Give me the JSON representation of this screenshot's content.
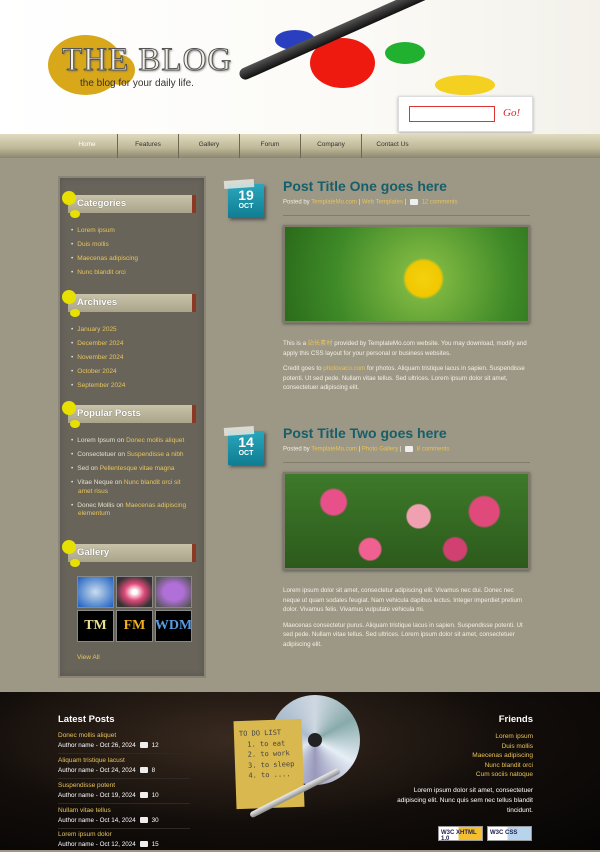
{
  "header": {
    "logo_title": "THE BLOG",
    "tagline": "the blog for your daily life.",
    "search_placeholder": "",
    "search_button": "Go!"
  },
  "nav": [
    {
      "label": "Home",
      "active": true
    },
    {
      "label": "Features"
    },
    {
      "label": "Gallery"
    },
    {
      "label": "Forum"
    },
    {
      "label": "Company"
    },
    {
      "label": "Contact Us"
    }
  ],
  "sidebar": {
    "categories": {
      "title": "Categories",
      "items": [
        "Lorem ipsum",
        "Duis mollis",
        "Maecenas adipiscing",
        "Nunc blandit orci"
      ]
    },
    "archives": {
      "title": "Archives",
      "items": [
        "January 2025",
        "December 2024",
        "November 2024",
        "October 2024",
        "September 2024"
      ]
    },
    "popular": {
      "title": "Popular Posts",
      "items": [
        {
          "author": "Lorem Ipsum",
          "on": "on",
          "link": "Donec mollis aliquet"
        },
        {
          "author": "Consectetuer",
          "on": "on",
          "link": "Suspendisse a nibh"
        },
        {
          "author": "Sed",
          "on": "on",
          "link": "Pellentesque vitae magna"
        },
        {
          "author": "Vitae Neque",
          "on": "on",
          "link": "Nunc blandit orci sit amet risus"
        },
        {
          "author": "Donec Mollis",
          "on": "on",
          "link": "Maecenas adipiscing elementum"
        }
      ]
    },
    "gallery": {
      "title": "Gallery",
      "thumbs": [
        "fish",
        "carnation",
        "petunia",
        "TM",
        "FM",
        "WDM"
      ],
      "view_all": "View All"
    }
  },
  "posts": [
    {
      "day": "19",
      "month": "OCT",
      "title": "Post Title One goes here",
      "posted_by": "Posted by",
      "author": "TemplateMo.com",
      "sep": "|",
      "category": "Web Templates",
      "comments": "12 comments",
      "p1_pre": "This is a ",
      "p1_link": "站长素材",
      "p1_post": " provided by TemplateMo.com website. You may download, modify and apply this CSS layout for your personal or business websites.",
      "p2_pre": "Credit goes to ",
      "p2_link": "photovaco.com",
      "p2_post": " for photos. Aliquam tristique lacus in sapien. Suspendisse potenti. Ut sed pede. Nullam vitae tellus. Sed ultrices. Lorem ipsum dolor sit amet, consectetuer adipiscing elit."
    },
    {
      "day": "14",
      "month": "OCT",
      "title": "Post Title Two goes here",
      "posted_by": "Posted by",
      "author": "TemplateMo.com",
      "sep": "|",
      "category": "Photo Gallery",
      "comments": "8 comments",
      "p1": "Lorem ipsum dolor sit amet, consectetur adipiscing elit. Vivamus nec dui. Donec nec neque ut quam sodales feugiat. Nam vehicula dapibus lectus. Integer imperdiet pretium dolor. Vivamus felis. Vivamus vulputate vehicula mi.",
      "p2": "Maecenas consectetur purus. Aliquam tristique lacus in sapien. Suspendisse potenti. Ut sed pede. Nullam vitae tellus. Sed ultrices. Lorem ipsum dolor sit amet, consectetuer adipiscing elit."
    }
  ],
  "footer": {
    "latest_title": "Latest Posts",
    "latest": [
      {
        "title": "Donec mollis aliquet",
        "meta": "Author name - Oct 26, 2024",
        "comments": "12"
      },
      {
        "title": "Aliquam tristique lacust",
        "meta": "Author name - Oct 24, 2024",
        "comments": "8"
      },
      {
        "title": "Suspendisse potent",
        "meta": "Author name - Oct 19, 2024",
        "comments": "10"
      },
      {
        "title": "Nullam vitae tellus",
        "meta": "Author name - Oct 14, 2024",
        "comments": "30"
      },
      {
        "title": "Lorem ipsum dolor",
        "meta": "Author name - Oct 12, 2024",
        "comments": "15"
      }
    ],
    "todo": {
      "title": "TO DO LIST",
      "items": [
        "1. to eat",
        "2. to work",
        "3. to sleep",
        "4. to ...."
      ]
    },
    "friends_title": "Friends",
    "friends": [
      "Lorem ipsum",
      "Duis mollis",
      "Maecenas adipiscing",
      "Nunc blandit orci",
      "Cum sociis natoque"
    ],
    "friends_text": "Lorem ipsum dolor sit amet, consectetuer adipiscing elit. Nunc quis sem nec tellus blandit tincidunt.",
    "badges": [
      "W3C XHTML 1.0",
      "W3C CSS"
    ]
  },
  "colors": {
    "link": "#e8c45a",
    "title": "#165f6a",
    "date_badge": "#1a93a8"
  }
}
